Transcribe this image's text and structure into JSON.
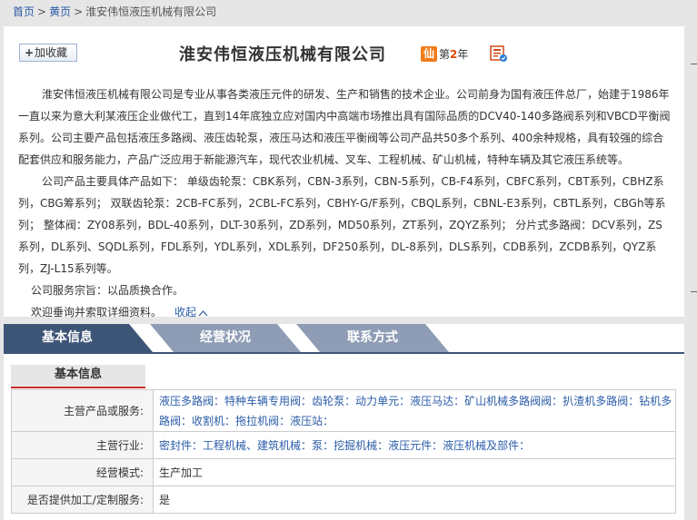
{
  "breadcrumb": {
    "home": "首页",
    "yellow_pages": "黄页",
    "separator": ">",
    "current": "淮安伟恒液压机械有限公司"
  },
  "header": {
    "favorite_label": "加收藏",
    "company_name": "淮安伟恒液压机械有限公司",
    "year_icon_text": "仙",
    "year_prefix": "第",
    "year_number": "2",
    "year_suffix": "年"
  },
  "description": {
    "p1": "淮安伟恒液压机械有限公司是专业从事各类液压元件的研发、生产和销售的技术企业。公司前身为国有液压件总厂，始建于1986年一直以来为意大利某液压企业做代工，直到14年底独立应对国内中高端市场推出具有国际品质的DCV40-140多路阀系列和VBCD平衡阀系列。公司主要产品包括液压多路阀、液压齿轮泵，液压马达和液压平衡阀等公司产品共50多个系列、400余种规格，具有较强的综合配套供应和服务能力，产品广泛应用于新能源汽车，现代农业机械、叉车、工程机械、矿山机械，特种车辆及其它液压系统等。",
    "p2": "公司产品主要具体产品如下：  单级齿轮泵：CBK系列，CBN-3系列，CBN-5系列，CB-F4系列，CBFC系列，CBT系列，CBHZ系列，CBG筹系列；  双联齿轮泵：2CB-FC系列，2CBL-FC系列，CBHY-G/F系列，CBQL系列，CBNL-E3系列，CBTL系列，CBGh等系列；  整体阀：ZY08系列，BDL-40系列，DLT-30系列，ZD系列，MD50系列，ZT系列，ZQYZ系列；  分片式多路阀：DCV系列，ZS系列，DL系列、SQDL系列，FDL系列，YDL系列，XDL系列，DF250系列，DL-8系列，DLS系列，CDB系列，ZCDB系列，QYZ系列，ZJ-L15系列等。",
    "p3": "公司服务宗旨：以品质换合作。",
    "p4": "欢迎垂询并索取详细资料。",
    "collapse_label": "收起"
  },
  "tabs": [
    {
      "label": "基本信息",
      "active": true
    },
    {
      "label": "经营状况",
      "active": false
    },
    {
      "label": "联系方式",
      "active": false
    }
  ],
  "basic_info": {
    "heading": "基本信息",
    "rows": [
      {
        "label": "主营产品或服务:",
        "values": [
          "液压多路阀",
          "特种车辆专用阀",
          "齿轮泵",
          "动力单元",
          "液压马达",
          "矿山机械多路阀阀",
          "扒渣机多路阀",
          "钻机多路阀",
          "收割机",
          "拖拉机阀",
          "液压站"
        ],
        "links": true
      },
      {
        "label": "主营行业:",
        "values": [
          "密封件",
          "工程机械、建筑机械",
          "泵",
          "挖掘机械",
          "液压元件",
          "液压机械及部件"
        ],
        "links": true
      },
      {
        "label": "经营模式:",
        "values": [
          "生产加工"
        ],
        "links": false
      },
      {
        "label": "是否提供加工/定制服务:",
        "values": [
          "是"
        ],
        "links": false
      }
    ]
  },
  "colors": {
    "link": "#2a5ca8",
    "tab_active": "#3d5577",
    "tab_inactive": "#8e9db5",
    "accent_red": "#c9302c",
    "year_orange": "#f07c1b"
  }
}
